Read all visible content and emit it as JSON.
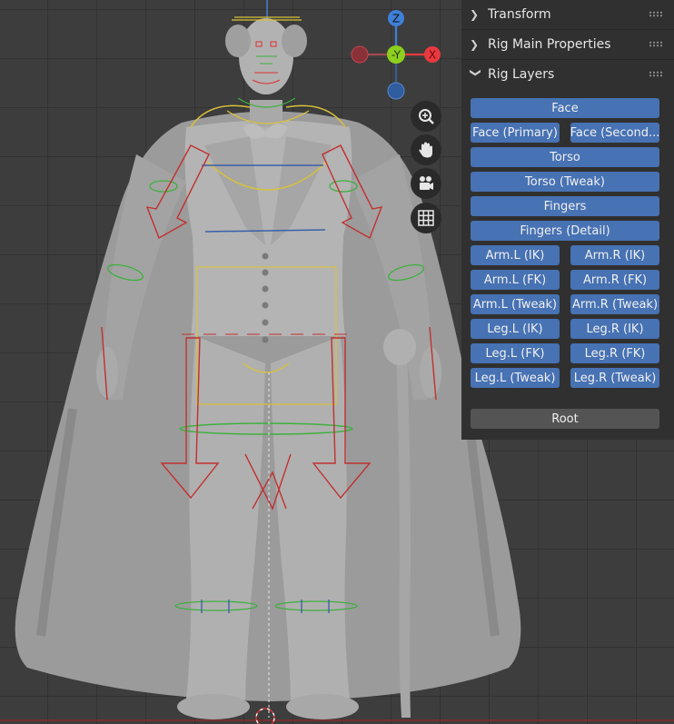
{
  "panel": {
    "sections": [
      {
        "label": "Transform",
        "expanded": false
      },
      {
        "label": "Rig Main Properties",
        "expanded": false
      },
      {
        "label": "Rig Layers",
        "expanded": true
      }
    ],
    "layers": {
      "face": "Face",
      "face_primary": "Face (Primary)",
      "face_secondary": "Face (Second...",
      "torso": "Torso",
      "torso_tweak": "Torso (Tweak)",
      "fingers": "Fingers",
      "fingers_detail": "Fingers (Detail)",
      "arm_l_ik": "Arm.L (IK)",
      "arm_r_ik": "Arm.R (IK)",
      "arm_l_fk": "Arm.L (FK)",
      "arm_r_fk": "Arm.R (FK)",
      "arm_l_tweak": "Arm.L (Tweak)",
      "arm_r_tweak": "Arm.R (Tweak)",
      "leg_l_ik": "Leg.L (IK)",
      "leg_r_ik": "Leg.R (IK)",
      "leg_l_fk": "Leg.L (FK)",
      "leg_r_fk": "Leg.R (FK)",
      "leg_l_tweak": "Leg.L (Tweak)",
      "leg_r_tweak": "Leg.R (Tweak)",
      "root": "Root"
    }
  },
  "gizmo": {
    "z": "Z",
    "neg_y": "-Y",
    "x": "X"
  },
  "nav_icons": [
    "zoom-icon",
    "hand-pan-icon",
    "camera-icon",
    "grid-icon"
  ],
  "colors": {
    "active_layer": "#4772b3",
    "inactive_layer": "#545454",
    "panel_bg": "#303030",
    "viewport_bg": "#3d3d3d",
    "axis_x": "#e8393f",
    "axis_y": "#8ccf1c",
    "axis_z": "#3e80d8"
  }
}
